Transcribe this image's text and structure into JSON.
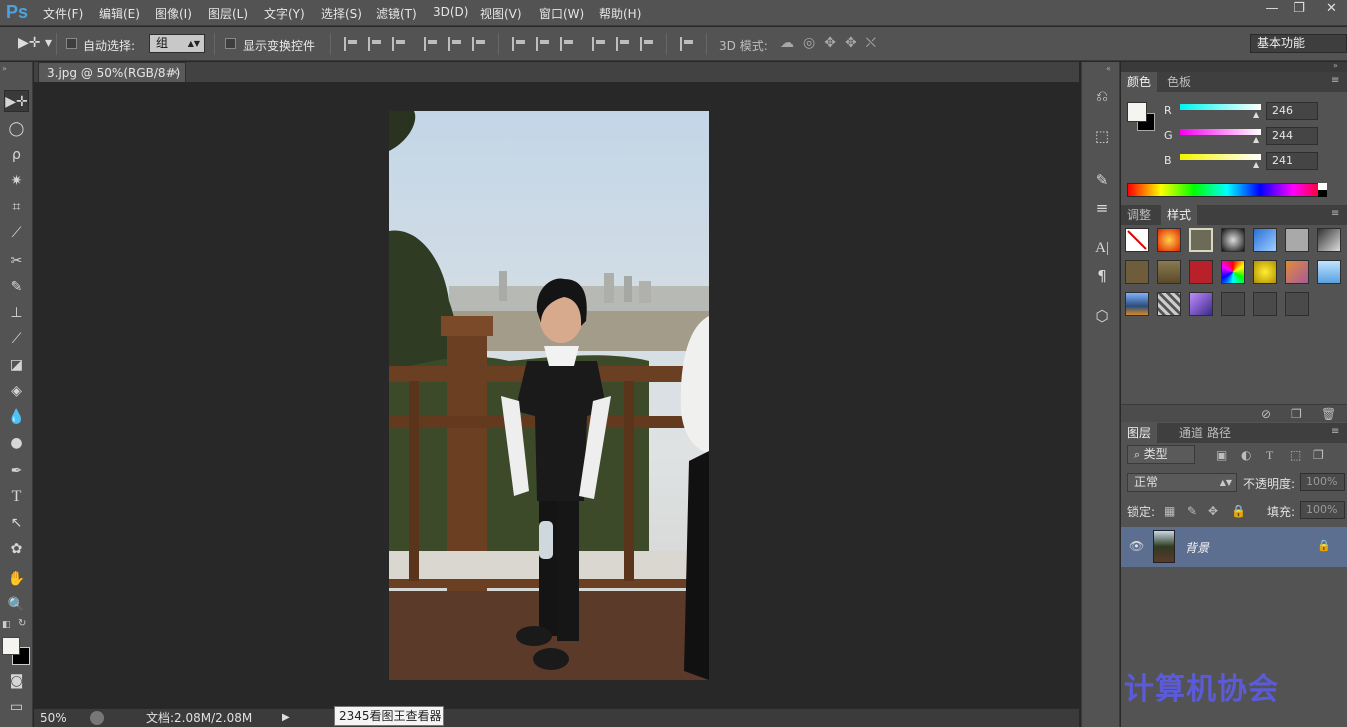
{
  "app": {
    "logo": "Ps"
  },
  "menu": [
    "文件(F)",
    "编辑(E)",
    "图像(I)",
    "图层(L)",
    "文字(Y)",
    "选择(S)",
    "滤镜(T)",
    "3D(D)",
    "视图(V)",
    "窗口(W)",
    "帮助(H)"
  ],
  "window_controls": {
    "minimize": "—",
    "restore": "❐",
    "close": "✕"
  },
  "options": {
    "auto_select_label": "自动选择:",
    "auto_select_value": "组",
    "show_transform_label": "显示变换控件",
    "mode3d_label": "3D 模式:",
    "workspace": "基本功能"
  },
  "document": {
    "tab_title": "3.jpg @ 50%(RGB/8#)",
    "close": "×"
  },
  "status": {
    "zoom": "50%",
    "doc_info": "文档:2.08M/2.08M",
    "tooltip": "2345看图王查看器"
  },
  "color_panel": {
    "tabs": [
      "颜色",
      "色板"
    ],
    "channels": [
      {
        "label": "R",
        "value": "246",
        "color": "#32d9d9"
      },
      {
        "label": "G",
        "value": "244",
        "color": "#d63fd6"
      },
      {
        "label": "B",
        "value": "241",
        "color": "#e1e13a"
      }
    ]
  },
  "styles_panel": {
    "tabs": [
      "调整",
      "样式"
    ]
  },
  "layers_panel": {
    "tabs": [
      "图层",
      "通道",
      "路径"
    ],
    "filter_label": "类型",
    "blend_mode": "正常",
    "opacity_label": "不透明度:",
    "opacity_value": "100%",
    "lock_label": "锁定:",
    "fill_label": "填充:",
    "fill_value": "100%",
    "layer_name": "背景"
  },
  "watermark": "计算机协会",
  "colors": {
    "ui_bg": "#535353",
    "canvas_bg": "#282828",
    "accent": "#4aa3df",
    "selected_layer": "#5d6f91"
  }
}
